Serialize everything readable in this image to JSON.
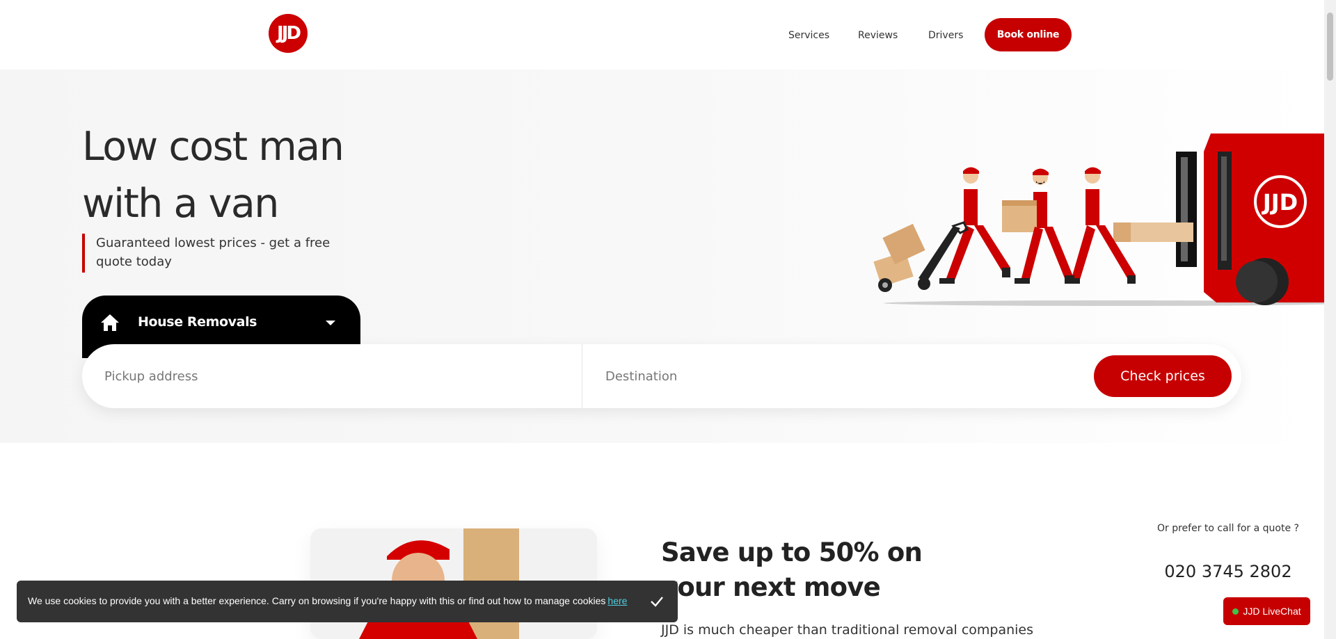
{
  "header": {
    "logo_text": "JJD",
    "nav": [
      "Services",
      "Reviews",
      "Drivers"
    ],
    "book_label": "Book online"
  },
  "hero": {
    "title_line1": "Low cost man",
    "title_line2": "with a van",
    "subtitle": "Guaranteed lowest prices - get a free quote today",
    "service_selected": "House Removals",
    "pickup_placeholder": "Pickup address",
    "destination_placeholder": "Destination",
    "check_label": "Check prices"
  },
  "section2": {
    "title": "Save up to 50% on your next move",
    "text": "JJD is much cheaper than traditional removal companies",
    "call_label": "Or prefer to call for a quote ?",
    "call_number": "020 3745 2802"
  },
  "cookie": {
    "text": "We use cookies to provide you with a better experience. Carry on browsing if you're happy with this or find out how to manage cookies",
    "link": "here"
  },
  "livechat": {
    "label": "JJD LiveChat"
  },
  "colors": {
    "accent": "#c60000",
    "dark": "#000000",
    "cookie_bg": "#333333"
  },
  "icons": [
    "home-icon",
    "caret-down-icon",
    "check-icon",
    "online-dot-icon"
  ]
}
